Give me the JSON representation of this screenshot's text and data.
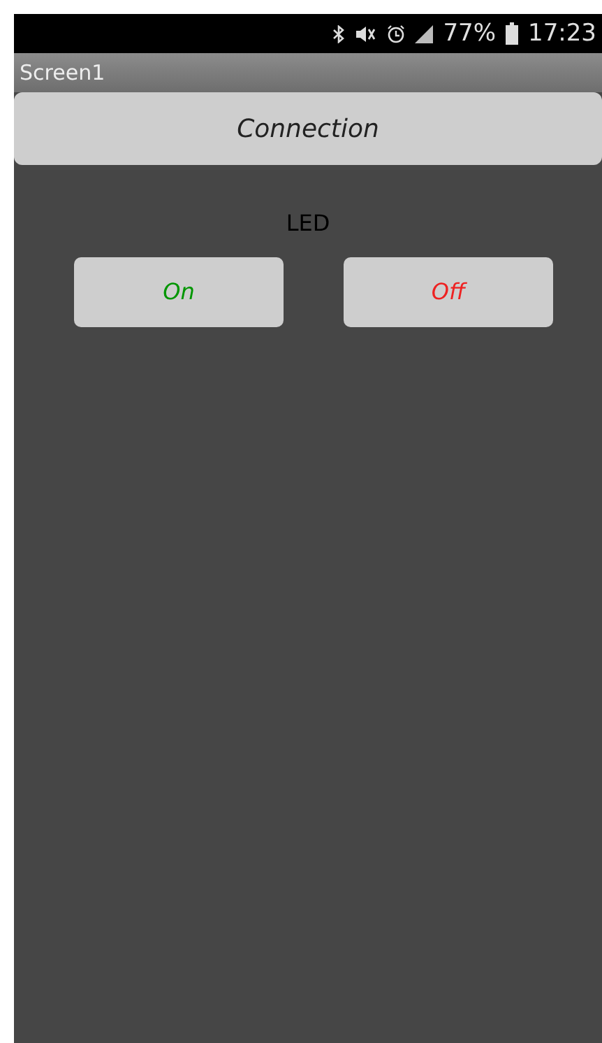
{
  "status_bar": {
    "battery": "77%",
    "time": "17:23"
  },
  "title_bar": {
    "title": "Screen1"
  },
  "connection_button": {
    "label": "Connection"
  },
  "led_label": "LED",
  "buttons": [
    {
      "label": "On",
      "color": "#009600"
    },
    {
      "label": "Off",
      "color": "#ee2222"
    }
  ]
}
